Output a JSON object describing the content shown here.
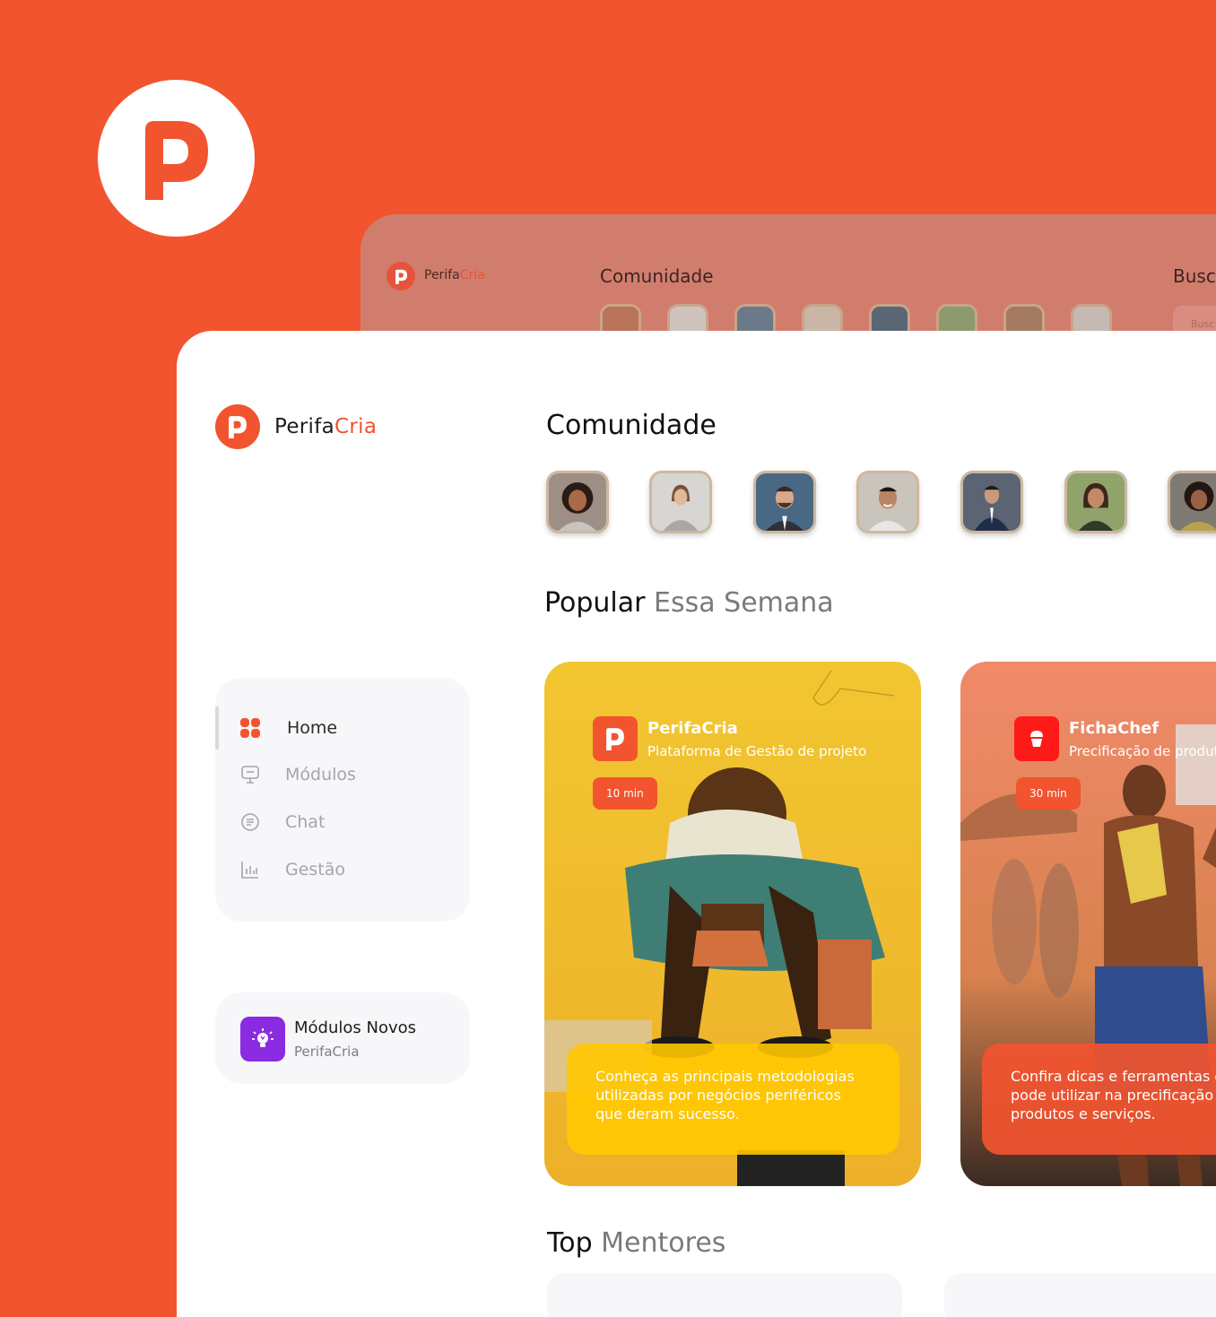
{
  "brand": {
    "name_part1": "Perifa",
    "name_part2": "Cria",
    "primary_color": "#F2542F",
    "accent_purple": "#8A2BE2"
  },
  "back_window": {
    "section_title": "Comunidade",
    "search_title": "Busca",
    "search_placeholder": "Busc"
  },
  "sidebar": {
    "items": [
      {
        "label": "Home",
        "icon": "grid-icon",
        "active": true
      },
      {
        "label": "Módulos",
        "icon": "monitor-icon",
        "active": false
      },
      {
        "label": "Chat",
        "icon": "chat-icon",
        "active": false
      },
      {
        "label": "Gestão",
        "icon": "chart-icon",
        "active": false
      }
    ],
    "promo": {
      "title": "Módulos Novos",
      "subtitle": "PerifaCria",
      "icon": "lightbulb-icon"
    }
  },
  "community": {
    "title": "Comunidade"
  },
  "popular": {
    "title": "Popular",
    "subtitle": "Essa Semana",
    "cards": [
      {
        "app_name": "PerifaCria",
        "app_desc": "Plataforma de Gestão de projeto",
        "time": "10 min",
        "description": "Conheça as principais metodologias utilizadas por negócios periféricos que deram sucesso."
      },
      {
        "app_name": "FichaChef",
        "app_desc": "Precificação de produtos",
        "time": "30 min",
        "description": "Confira dicas e ferramentas que você pode utilizar na precificação de seus produtos e serviços."
      }
    ]
  },
  "mentors": {
    "title": "Top",
    "subtitle": "Mentores"
  }
}
